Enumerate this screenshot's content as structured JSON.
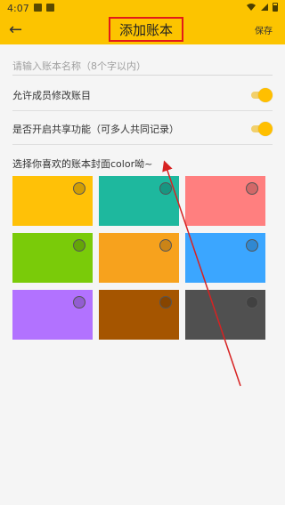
{
  "status_bar": {
    "time": "4:07"
  },
  "header": {
    "title": "添加账本",
    "save_label": "保存"
  },
  "name_field": {
    "placeholder": "请输入账本名称（8个字以内）",
    "value": ""
  },
  "settings": [
    {
      "label": "允许成员修改账目",
      "enabled": true
    },
    {
      "label": "是否开启共享功能（可多人共同记录）",
      "enabled": true
    }
  ],
  "color_section": {
    "title": "选择你喜欢的账本封面color呦~",
    "swatches": [
      {
        "color": "#ffc107",
        "selected": false
      },
      {
        "color": "#1eb89e",
        "selected": false
      },
      {
        "color": "#ff7f7f",
        "selected": false
      },
      {
        "color": "#7acb09",
        "selected": false
      },
      {
        "color": "#f7a21d",
        "selected": false
      },
      {
        "color": "#3ba6ff",
        "selected": false
      },
      {
        "color": "#b272ff",
        "selected": false
      },
      {
        "color": "#a55500",
        "selected": false
      },
      {
        "color": "#505050",
        "selected": false
      }
    ]
  },
  "colors": {
    "accent": "#fcc400",
    "annotation": "#d72222"
  }
}
